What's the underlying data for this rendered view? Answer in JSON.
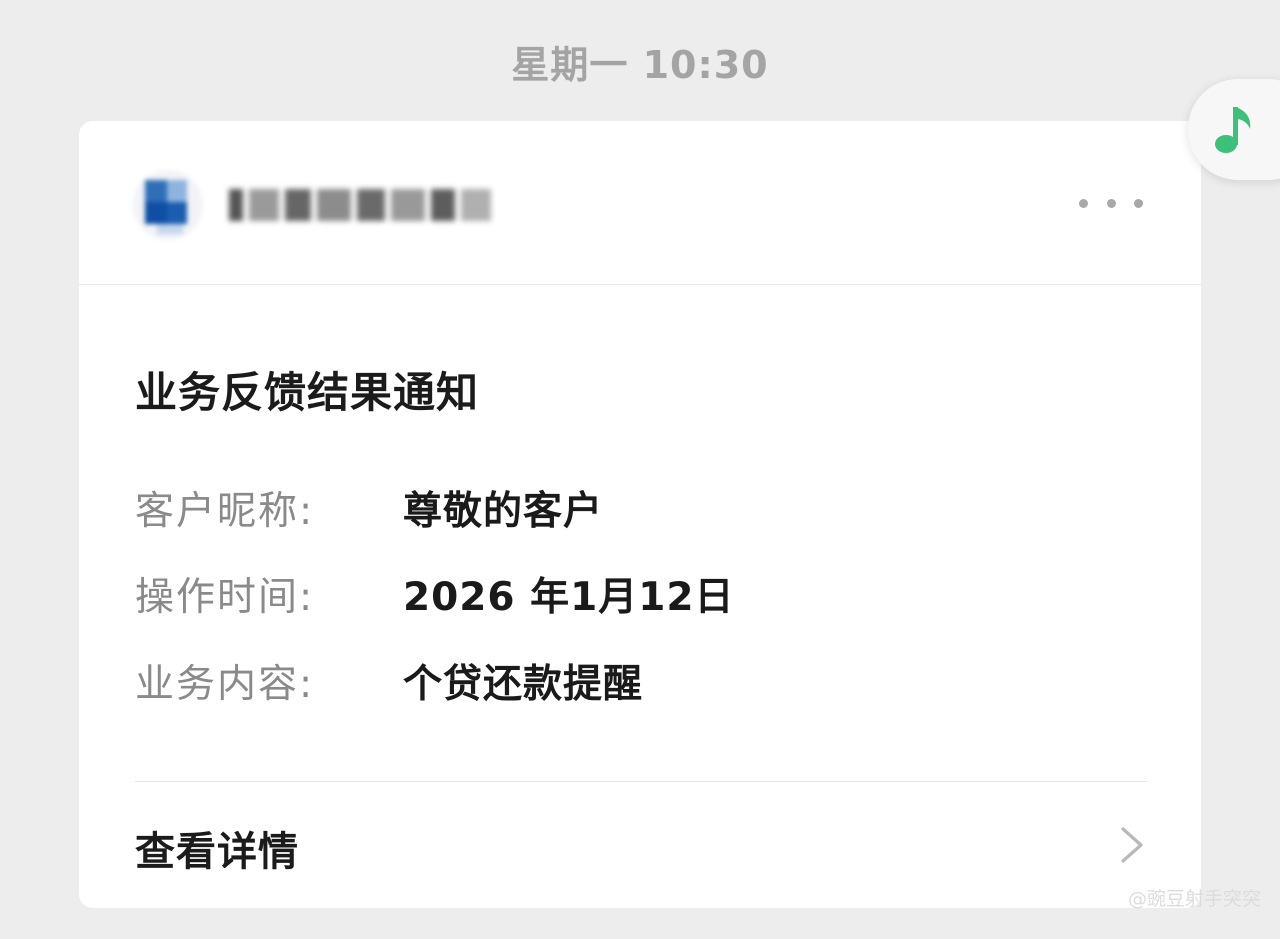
{
  "timestamp": "星期一 10:30",
  "card": {
    "account": {
      "avatar_icon": "bank-logo-icon",
      "more_icon": "more-dots-icon"
    },
    "title": "业务反馈结果通知",
    "fields": [
      {
        "label": "客户昵称:",
        "value": "尊敬的客户"
      },
      {
        "label": "操作时间:",
        "value": "2026 年1月12日"
      },
      {
        "label": "业务内容:",
        "value": "个贷还款提醒"
      }
    ],
    "details_label": "查看详情",
    "details_icon": "chevron-right-icon"
  },
  "floating_button": {
    "icon": "music-note-icon",
    "color": "#3ec07a"
  },
  "watermark": "@豌豆射手突突"
}
